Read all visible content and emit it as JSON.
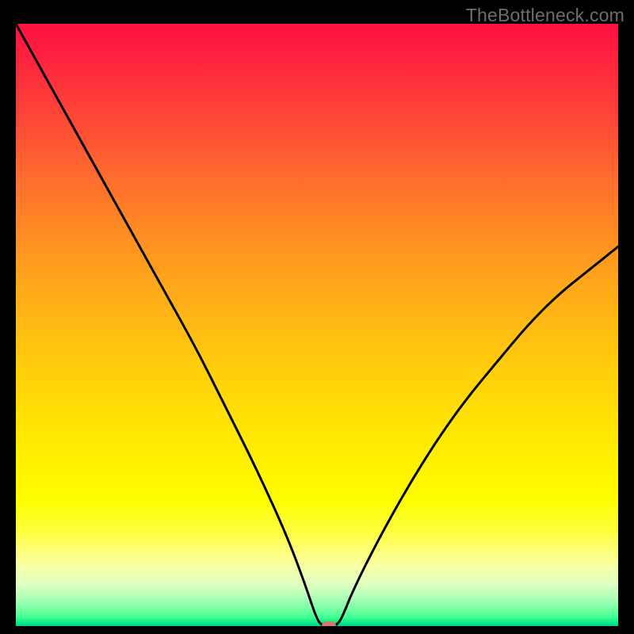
{
  "watermark": "TheBottleneck.com",
  "chart_data": {
    "type": "line",
    "title": "",
    "xlabel": "",
    "ylabel": "",
    "xlim": [
      0,
      100
    ],
    "ylim": [
      0,
      100
    ],
    "grid": false,
    "legend": false,
    "series": [
      {
        "name": "curve",
        "x": [
          0,
          5,
          10,
          15,
          20,
          25,
          30,
          35,
          40,
          45,
          48,
          50,
          51,
          52,
          53,
          54,
          56,
          60,
          65,
          70,
          75,
          80,
          85,
          90,
          95,
          100
        ],
        "values": [
          100,
          91,
          82,
          73,
          64,
          55,
          46,
          36,
          26,
          15,
          7,
          1,
          0,
          0,
          0,
          1,
          6,
          14,
          23,
          31,
          38,
          44,
          50,
          55,
          59,
          63
        ]
      }
    ],
    "marker": {
      "x": 52,
      "y": 0,
      "color": "#cf7b76"
    }
  }
}
